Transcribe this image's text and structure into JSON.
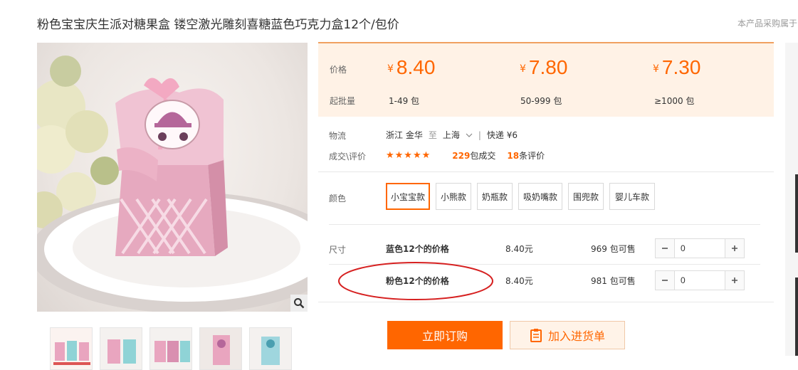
{
  "product": {
    "title": "粉色宝宝庆生派对糖果盒 镂空激光雕刻喜糖蓝色巧克力盒12个/包价",
    "side_note": "本产品采购属于"
  },
  "price_panel": {
    "price_label": "价格",
    "moq_label": "起批量",
    "currency": "¥",
    "tiers": [
      {
        "price": "8.40",
        "qty": "1-49 包"
      },
      {
        "price": "7.80",
        "qty": "50-999 包"
      },
      {
        "price": "7.30",
        "qty": "≥1000 包"
      }
    ]
  },
  "logistics": {
    "label": "物流",
    "origin": "浙江 金华",
    "to": "至",
    "destination": "上海",
    "shipping": "快递 ¥6"
  },
  "deals": {
    "label": "成交\\评价",
    "stars": "★★★★★",
    "deal_count": "229",
    "deal_suffix": "包成交",
    "review_count": "18",
    "review_suffix": "条评价"
  },
  "color": {
    "label": "颜色",
    "options": [
      "小宝宝款",
      "小熊款",
      "奶瓶款",
      "吸奶嘴款",
      "围兜款",
      "婴儿车款"
    ],
    "selected": "小宝宝款"
  },
  "size": {
    "label": "尺寸",
    "rows": [
      {
        "name": "蓝色12个的价格",
        "price": "8.40元",
        "stock": "969 包可售",
        "qty": "0"
      },
      {
        "name": "粉色12个的价格",
        "price": "8.40元",
        "stock": "981 包可售",
        "qty": "0"
      }
    ]
  },
  "actions": {
    "buy": "立即订购",
    "cart": "加入进货单"
  },
  "colors": {
    "accent": "#ff6600",
    "price_bg": "#fff2e6",
    "annotation": "#d62020"
  },
  "icons": {
    "zoom": "magnifier-icon",
    "chevron": "chevron-down-icon",
    "cart": "list-icon",
    "minus": "minus-icon",
    "plus": "plus-icon"
  }
}
